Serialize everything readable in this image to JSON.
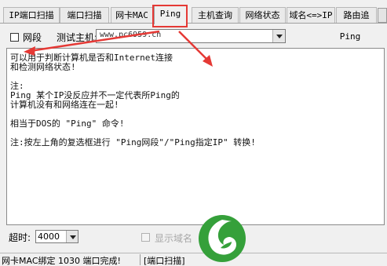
{
  "tabs": [
    {
      "label": "IP端口扫描",
      "active": false
    },
    {
      "label": "端口扫描",
      "active": false
    },
    {
      "label": "网卡MAC",
      "active": false
    },
    {
      "label": "Ping",
      "active": true
    },
    {
      "label": "主机查询",
      "active": false
    },
    {
      "label": "网络状态",
      "active": false
    },
    {
      "label": "域名<=>IP",
      "active": false
    },
    {
      "label": "路由追",
      "active": false
    }
  ],
  "toolbar": {
    "netseg_label": "网段",
    "netseg_checked": false,
    "host_label": "测试主机:",
    "host_value": "www.pc6959.cn",
    "ping_button": "Ping"
  },
  "output_lines": [
    "可以用于判断计算机是否和Internet连接",
    "和检测网络状态!",
    "",
    "注:",
    "Ping 某个IP没反应并不一定代表所Ping的",
    "计算机没有和网络连在一起!",
    "",
    "相当于DOS的 \"Ping\" 命令!",
    "",
    "注:按左上角的复选框进行 \"Ping网段\"/\"Ping指定IP\" 转换!"
  ],
  "bottom": {
    "timeout_label": "超时:",
    "timeout_value": "4000",
    "disabled_option_label": "显示域名"
  },
  "status": {
    "left": "网卡MAC绑定 1030 端口完成!",
    "right": "[端口扫描]"
  },
  "colors": {
    "highlight": "#e53935",
    "logo_green": "#35a03a"
  },
  "icons": [
    "combo-dropdown-icon",
    "leaf-logo-icon"
  ]
}
